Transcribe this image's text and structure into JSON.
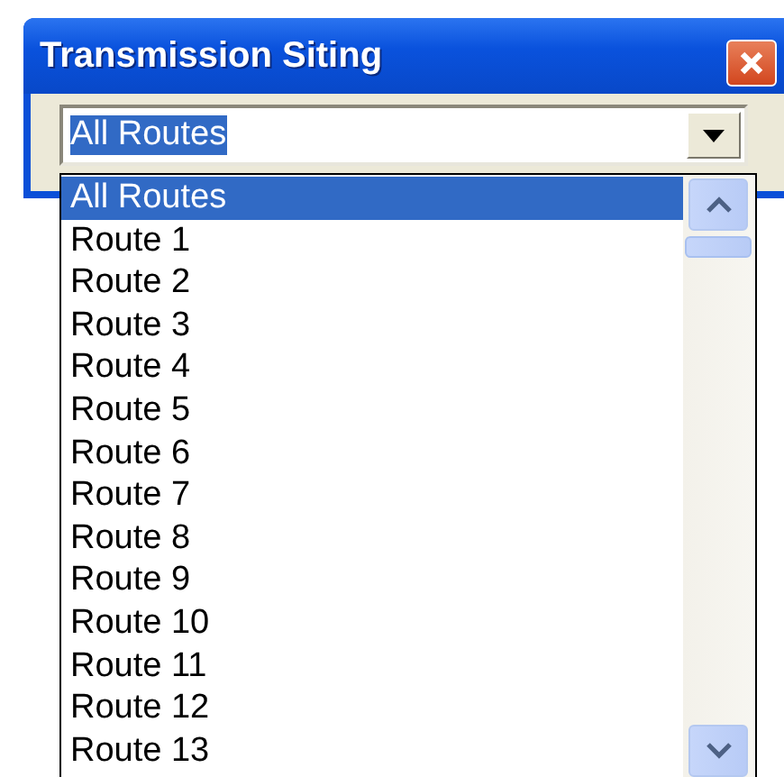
{
  "window": {
    "title": "Transmission Siting"
  },
  "combo": {
    "value": "All Routes"
  },
  "dropdown": {
    "items": [
      {
        "label": "All Routes",
        "selected": true
      },
      {
        "label": "Route 1",
        "selected": false
      },
      {
        "label": "Route 2",
        "selected": false
      },
      {
        "label": "Route 3",
        "selected": false
      },
      {
        "label": "Route 4",
        "selected": false
      },
      {
        "label": "Route 5",
        "selected": false
      },
      {
        "label": "Route 6",
        "selected": false
      },
      {
        "label": "Route 7",
        "selected": false
      },
      {
        "label": "Route 8",
        "selected": false
      },
      {
        "label": "Route 9",
        "selected": false
      },
      {
        "label": "Route 10",
        "selected": false
      },
      {
        "label": "Route 11",
        "selected": false
      },
      {
        "label": "Route 12",
        "selected": false
      },
      {
        "label": "Route 13",
        "selected": false
      }
    ]
  }
}
